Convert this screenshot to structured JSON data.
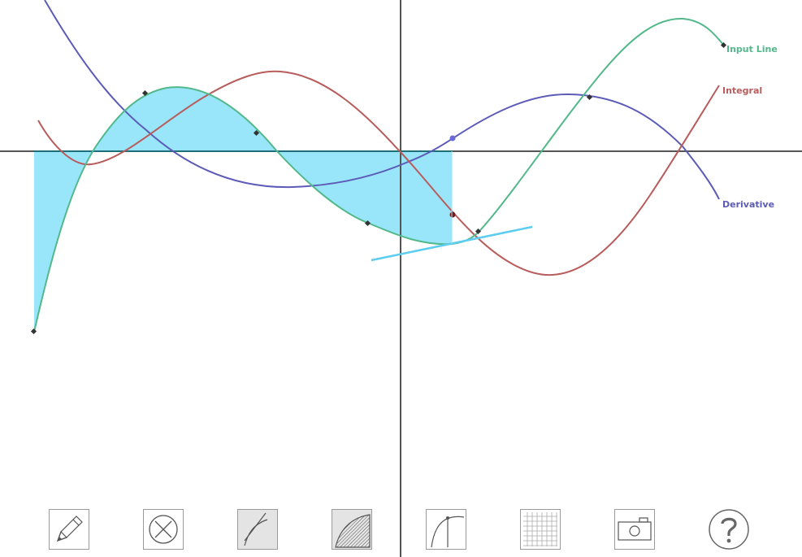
{
  "labels": {
    "input": "Input Line",
    "integral": "Integral",
    "derivative": "Derivative"
  },
  "colors": {
    "input": "#52b88a",
    "integral": "#b85c5c",
    "derivative": "#5c5cb8",
    "area": "#99e6fa",
    "tangent": "#5ccdf0",
    "axis": "#555555",
    "handle": "#333333"
  },
  "toolbar": [
    {
      "name": "pencil-tool-button",
      "icon": "pencil-icon",
      "active": false
    },
    {
      "name": "clear-tool-button",
      "icon": "clear-x-icon",
      "active": false
    },
    {
      "name": "derivative-tool-button",
      "icon": "derivative-curve-icon",
      "active": true
    },
    {
      "name": "integral-tool-button",
      "icon": "integral-area-icon",
      "active": true
    },
    {
      "name": "tangent-tool-button",
      "icon": "tangent-curve-icon",
      "active": false
    },
    {
      "name": "grid-tool-button",
      "icon": "grid-icon",
      "active": false
    },
    {
      "name": "camera-tool-button",
      "icon": "camera-icon",
      "active": false
    },
    {
      "name": "help-tool-button",
      "icon": "help-question-icon",
      "active": false
    }
  ]
}
